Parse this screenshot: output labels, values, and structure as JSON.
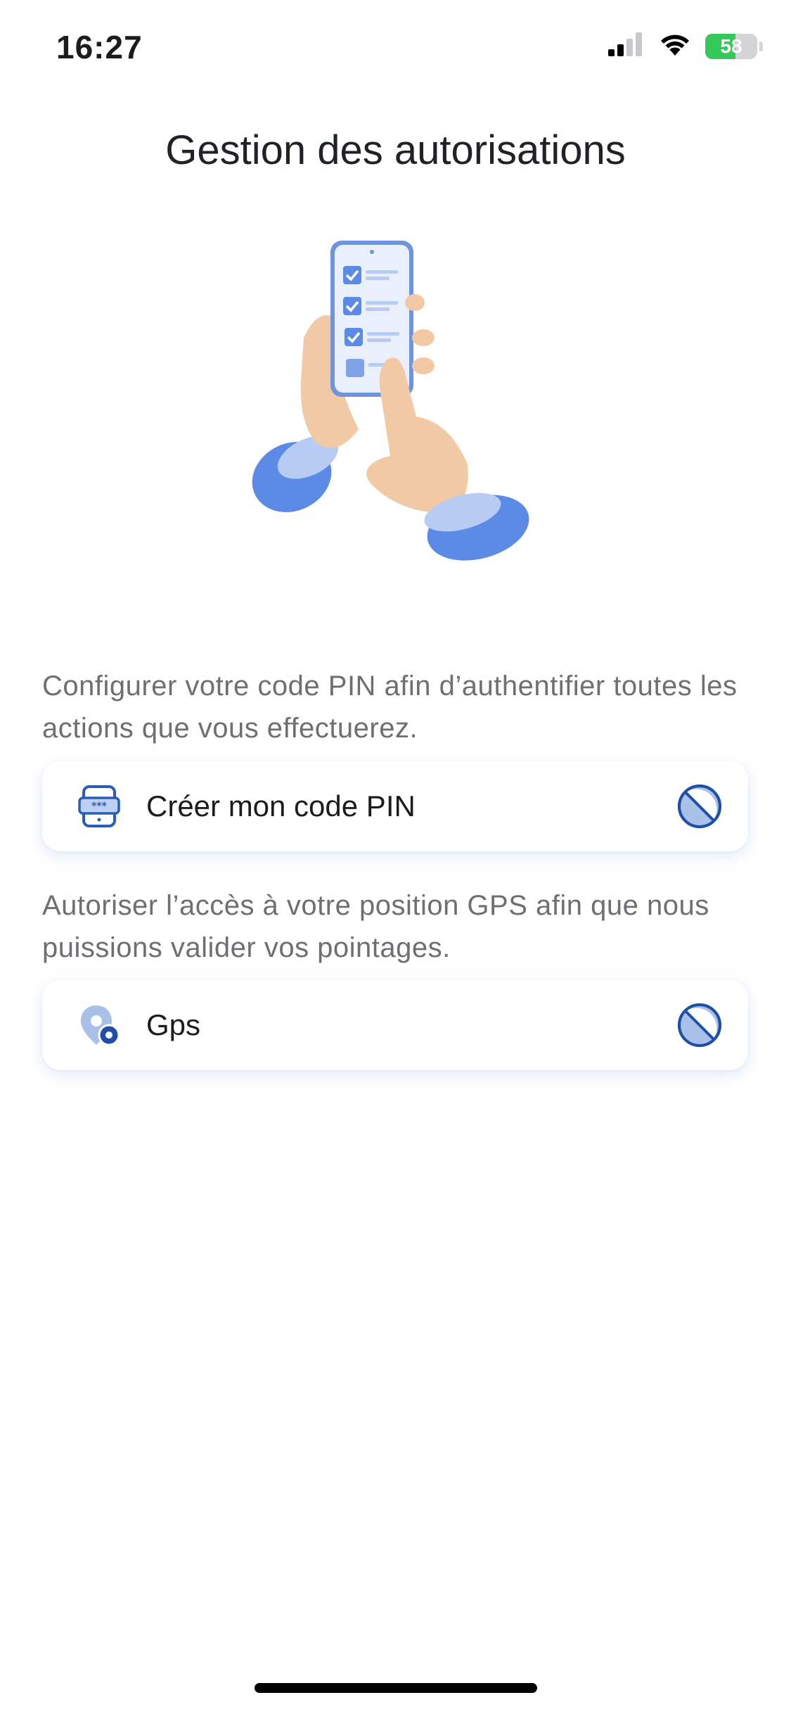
{
  "status_bar": {
    "time": "16:27",
    "battery_level": "58",
    "icons": [
      "cellular-signal-icon",
      "wifi-icon",
      "battery-charging-icon"
    ]
  },
  "page": {
    "title": "Gestion des autorisations",
    "illustration": "hands-holding-phone-checklist-illustration"
  },
  "permissions": [
    {
      "description": "Configurer votre code PIN afin d’authentifier toutes les actions que vous effectuerez.",
      "label": "Créer mon code PIN",
      "icon": "pin-code-icon",
      "status_icon": "not-granted-icon"
    },
    {
      "description": "Autoriser l’accès à votre position GPS afin que nous puissions valider vos pointages.",
      "label": "Gps",
      "icon": "location-pin-icon",
      "status_icon": "not-granted-icon"
    }
  ],
  "colors": {
    "accent": "#1f4fa8",
    "accent_light": "#a9c0e8",
    "battery_green": "#34c759"
  }
}
